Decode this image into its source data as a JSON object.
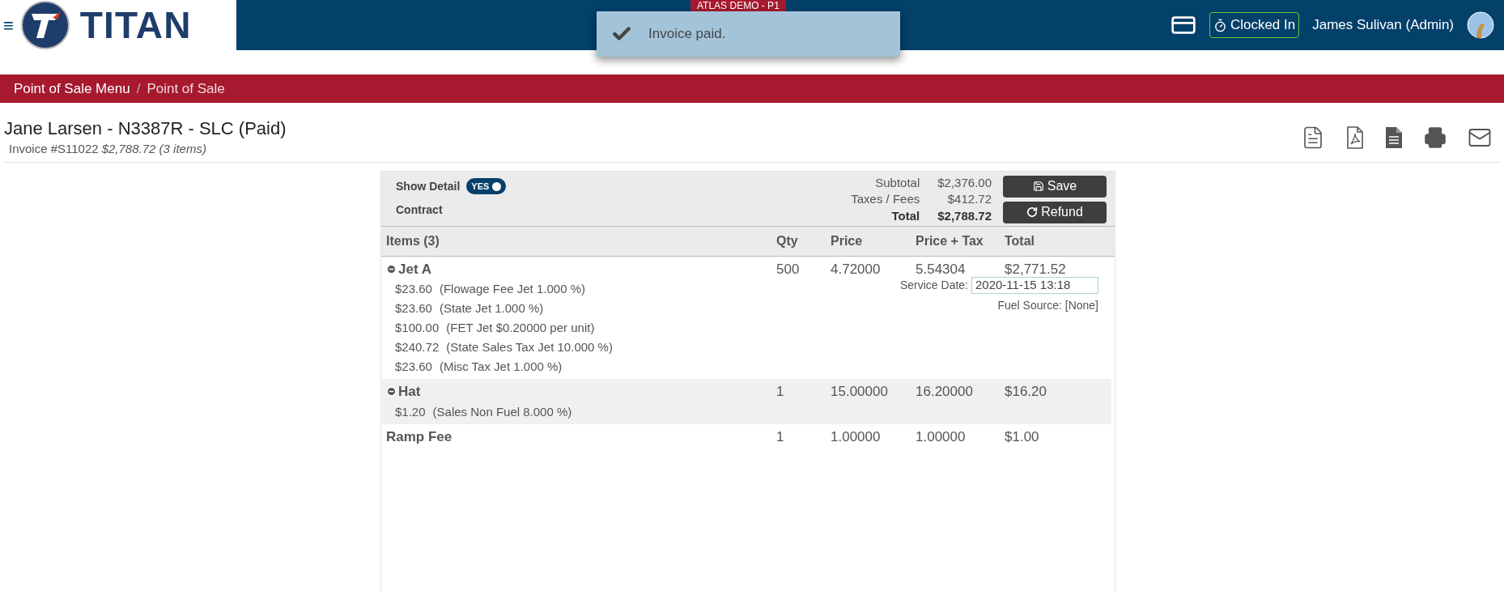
{
  "header": {
    "menu_glyph": "≡",
    "logo_text": "TITAN",
    "env_badge": "ATLAS DEMO - P1",
    "clock_status": "Clocked In",
    "user": "James Sulivan (Admin)"
  },
  "toast": {
    "message": "Invoice paid."
  },
  "breadcrumb": [
    {
      "label": "Point of Sale Menu"
    },
    {
      "label": "Point of Sale"
    }
  ],
  "breadcrumb_separator": "/",
  "invoice": {
    "title": "Jane Larsen - N3387R - SLC (Paid)",
    "number": "Invoice #S11022",
    "summary": "$2,788.72 (3 items)"
  },
  "panel": {
    "show_detail": {
      "label": "Show Detail",
      "on": true,
      "text": "YES"
    },
    "contract_label": "Contract",
    "totals": [
      {
        "label": "Subtotal",
        "value": "$2,376.00",
        "bold": false
      },
      {
        "label": "Taxes / Fees",
        "value": "$412.72",
        "bold": false
      },
      {
        "label": "Total",
        "value": "$2,788.72",
        "bold": true
      }
    ],
    "buttons": [
      {
        "kind": "save",
        "label": "Save"
      },
      {
        "kind": "refund",
        "label": "Refund"
      }
    ]
  },
  "table": {
    "columns": [
      "Items (3)",
      "Qty",
      "Price",
      "Price + Tax",
      "Total"
    ],
    "rows": [
      {
        "name": "Jet A",
        "expanded": true,
        "qty": "500",
        "price": "4.72000",
        "price_tax": "5.54304",
        "total": "$2,771.52",
        "details": [
          {
            "amount": "$23.60",
            "desc": "(Flowage Fee Jet 1.000 %)"
          },
          {
            "amount": "$23.60",
            "desc": "(State Jet 1.000 %)"
          },
          {
            "amount": "$100.00",
            "desc": "(FET Jet $0.20000 per unit)"
          },
          {
            "amount": "$240.72",
            "desc": "(State Sales Tax Jet 10.000 %)"
          },
          {
            "amount": "$23.60",
            "desc": "(Misc Tax Jet 1.000 %)"
          }
        ],
        "service_date_label": "Service Date:",
        "service_date": "2020-11-15 13:18",
        "fuel_source": "Fuel Source: [None]"
      },
      {
        "name": "Hat",
        "expanded": true,
        "qty": "1",
        "price": "15.00000",
        "price_tax": "16.20000",
        "total": "$16.20",
        "details": [
          {
            "amount": "$1.20",
            "desc": "(Sales Non Fuel 8.000 %)"
          }
        ]
      },
      {
        "name": "Ramp Fee",
        "qty": "1",
        "price": "1.00000",
        "price_tax": "1.00000",
        "total": "$1.00",
        "details": []
      }
    ]
  }
}
